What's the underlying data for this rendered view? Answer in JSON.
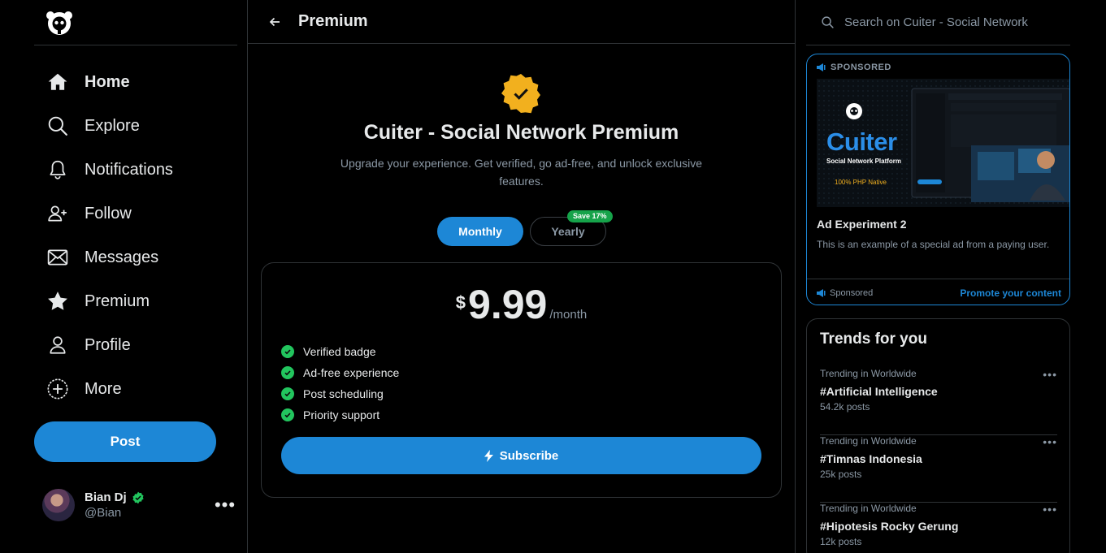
{
  "app": {
    "name": "Cuiter - Social Network"
  },
  "nav": [
    {
      "id": "home",
      "label": "Home",
      "icon": "home-icon"
    },
    {
      "id": "explore",
      "label": "Explore",
      "icon": "search-icon"
    },
    {
      "id": "notifications",
      "label": "Notifications",
      "icon": "bell-icon"
    },
    {
      "id": "follow",
      "label": "Follow",
      "icon": "user-plus-icon"
    },
    {
      "id": "messages",
      "label": "Messages",
      "icon": "envelope-icon"
    },
    {
      "id": "premium",
      "label": "Premium",
      "icon": "star-icon"
    },
    {
      "id": "profile",
      "label": "Profile",
      "icon": "user-icon"
    },
    {
      "id": "more",
      "label": "More",
      "icon": "plus-circle-icon"
    }
  ],
  "post_button": "Post",
  "user": {
    "name": "Bian Dj",
    "handle": "@Bian",
    "more": "•••"
  },
  "main": {
    "title": "Premium",
    "premium_title": "Cuiter - Social Network Premium",
    "premium_subtitle": "Upgrade your experience. Get verified, go ad-free, and unlock exclusive features.",
    "toggle": {
      "monthly": "Monthly",
      "yearly": "Yearly",
      "save_tag": "Save 17%"
    },
    "plan": {
      "currency": "$",
      "price": "9.99",
      "period": "/month",
      "features": [
        "Verified badge",
        "Ad-free experience",
        "Post scheduling",
        "Priority support"
      ],
      "subscribe": "Subscribe"
    }
  },
  "right": {
    "search_placeholder": "Search on Cuiter - Social Network",
    "ad": {
      "label": "SPONSORED",
      "image_brand": "Cuiter",
      "image_sub": "Social Network Platform",
      "image_note": "100% PHP Native",
      "title": "Ad Experiment 2",
      "description": "This is an example of a special ad from a paying user.",
      "sponsored": "Sponsored",
      "promote": "Promote your content"
    },
    "trends": {
      "title": "Trends for you",
      "items": [
        {
          "context": "Trending in Worldwide",
          "name": "#Artificial Intelligence",
          "count": "54.2k posts"
        },
        {
          "context": "Trending in Worldwide",
          "name": "#Timnas Indonesia",
          "count": "25k posts"
        },
        {
          "context": "Trending in Worldwide",
          "name": "#Hipotesis Rocky Gerung",
          "count": "12k posts"
        }
      ],
      "more": "•••"
    }
  },
  "colors": {
    "accent": "#1d87d6",
    "gold": "#f2b01e",
    "green": "#22c55e",
    "background": "#000000",
    "border": "#2f3336"
  }
}
